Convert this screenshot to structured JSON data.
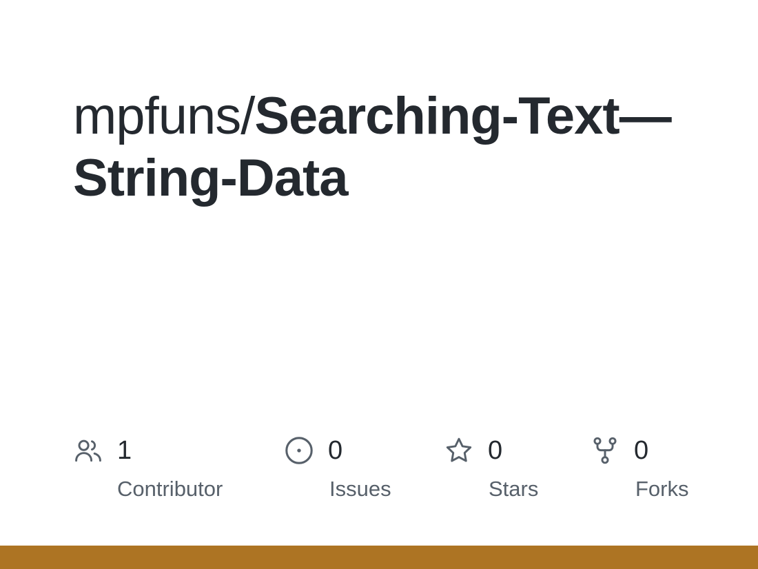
{
  "repo": {
    "owner": "mpfuns/",
    "name_line1": "Searching-Text—",
    "name_line2": "String-Data"
  },
  "stats": [
    {
      "icon": "people-icon",
      "count": "1",
      "label": "Contributor"
    },
    {
      "icon": "issue-icon",
      "count": "0",
      "label": "Issues"
    },
    {
      "icon": "star-icon",
      "count": "0",
      "label": "Stars"
    },
    {
      "icon": "fork-icon",
      "count": "0",
      "label": "Forks"
    }
  ],
  "colors": {
    "text": "#24292f",
    "muted": "#57606a",
    "icon": "#57606a",
    "accent_bar": "#ad7423"
  }
}
